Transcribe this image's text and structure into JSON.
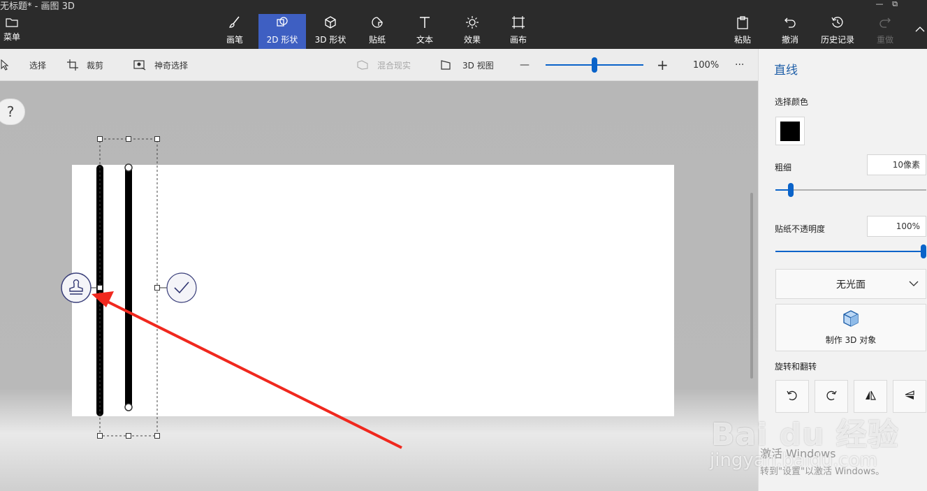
{
  "window": {
    "title": "无标题* - 画图 3D",
    "restore_glyph": "⧉"
  },
  "ribbon": {
    "menu_label": "菜单",
    "tabs": [
      {
        "label": "画笔",
        "icon": "brush-icon"
      },
      {
        "label": "2D 形状",
        "icon": "2d-shapes-icon",
        "active": true
      },
      {
        "label": "3D 形状",
        "icon": "3d-shapes-icon"
      },
      {
        "label": "贴纸",
        "icon": "stickers-icon"
      },
      {
        "label": "文本",
        "icon": "text-icon"
      },
      {
        "label": "效果",
        "icon": "effects-icon"
      },
      {
        "label": "画布",
        "icon": "canvas-icon"
      }
    ],
    "actions": [
      {
        "label": "粘贴",
        "icon": "paste-icon"
      },
      {
        "label": "撤消",
        "icon": "undo-icon"
      },
      {
        "label": "历史记录",
        "icon": "history-icon"
      },
      {
        "label": "重做",
        "icon": "redo-icon",
        "disabled": true
      }
    ]
  },
  "toolbar": {
    "select_label": "选择",
    "crop_label": "裁剪",
    "magic_select_label": "神奇选择",
    "mixed_reality_label": "混合现实",
    "view3d_label": "3D 视图",
    "zoom_out_glyph": "—",
    "zoom_in_glyph": "+",
    "zoom_level": 100,
    "zoom_text": "100%",
    "more_glyph": "···"
  },
  "canvas": {
    "help_glyph": "?"
  },
  "panel": {
    "title": "直线",
    "color_label": "选择颜色",
    "color": "#000000",
    "thickness_label": "粗细",
    "thickness_value": "10像素",
    "thickness_fraction": 0.1,
    "opacity_label": "贴纸不透明度",
    "opacity_value": "100%",
    "opacity_fraction": 1.0,
    "finish_value": "无光面",
    "make3d_label": "制作 3D 对象",
    "rotate_label": "旋转和翻转"
  },
  "watermark": {
    "activate_line1": "激活 Windows",
    "activate_line2": "转到\"设置\"以激活 Windows。",
    "brand": "Bai du 经验",
    "url": "jingyan.baidu.com"
  },
  "colors": {
    "accent": "#3e5fc2",
    "panel_title": "#1f5fa8",
    "slider": "#0a63c9",
    "annotation_arrow": "#f0281e"
  }
}
